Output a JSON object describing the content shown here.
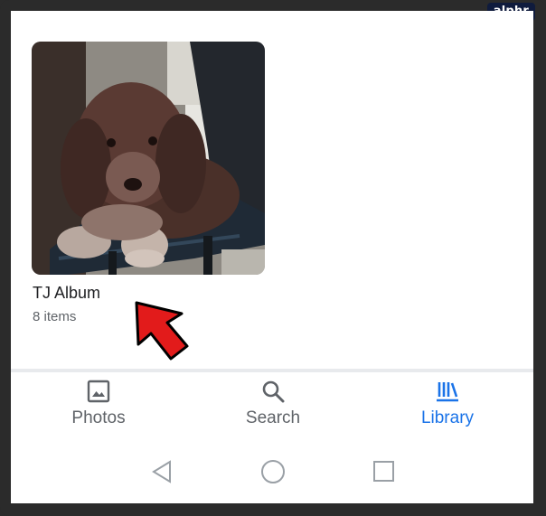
{
  "watermark": {
    "label": "alphr"
  },
  "album": {
    "title": "TJ Album",
    "count": "8 items",
    "thumbnail_icon": "dog-photo"
  },
  "tabs": [
    {
      "label": "Photos",
      "icon": "photo-icon",
      "active": false
    },
    {
      "label": "Search",
      "icon": "search-icon",
      "active": false
    },
    {
      "label": "Library",
      "icon": "library-icon",
      "active": true
    }
  ],
  "system_nav": {
    "back_icon": "back-triangle-icon",
    "home_icon": "home-circle-icon",
    "recents_icon": "recents-square-icon"
  },
  "colors": {
    "accent": "#1a73e8",
    "annotation_arrow": "#e21b1b",
    "text_primary": "#202124",
    "text_secondary": "#5f6368"
  }
}
